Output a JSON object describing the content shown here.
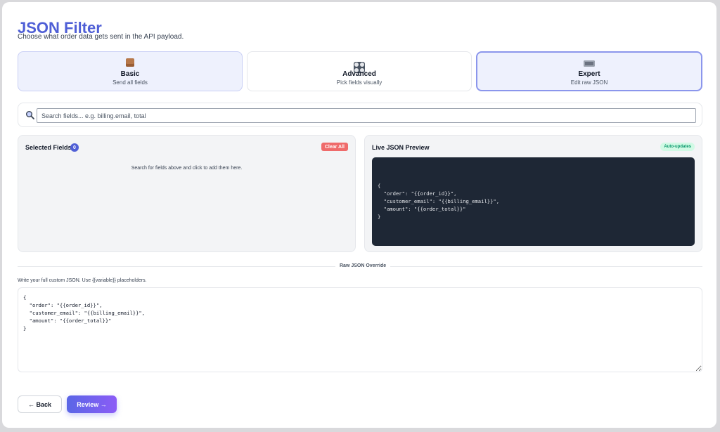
{
  "page": {
    "title": "JSON Filter",
    "subtitle": "Choose what order data gets sent in the API payload."
  },
  "modes": [
    {
      "icon": "box-icon",
      "title": "Basic",
      "desc": "Send all fields"
    },
    {
      "icon": "grid-icon",
      "title": "Advanced",
      "desc": "Pick fields visually"
    },
    {
      "icon": "keyboard-icon",
      "title": "Expert",
      "desc": "Edit raw JSON"
    }
  ],
  "search": {
    "placeholder": "Search fields... e.g. billing.email, total",
    "value": ""
  },
  "selected": {
    "title": "Selected Fields",
    "count": "0",
    "clear_label": "Clear All",
    "empty_text": "Search for fields above and click to add them here."
  },
  "preview": {
    "title": "Live JSON Preview",
    "badge": "Auto-updates",
    "code": "{\n  \"order\": \"{{order_id}}\",\n  \"customer_email\": \"{{billing_email}}\",\n  \"amount\": \"{{order_total}}\"\n}"
  },
  "raw": {
    "divider_label": "Raw JSON Override",
    "hint": "Write your full custom JSON. Use {{variable}} placeholders.",
    "value": "{\n  \"order\": \"{{order_id}}\",\n  \"customer_email\": \"{{billing_email}}\",\n  \"amount\": \"{{order_total}}\"\n}"
  },
  "footer": {
    "back_label": "← Back",
    "review_label": "Review →"
  },
  "colors": {
    "accent": "#4f5fd6",
    "danger": "#ef6b6b",
    "success": "#059669",
    "code_bg": "#1e2735"
  }
}
